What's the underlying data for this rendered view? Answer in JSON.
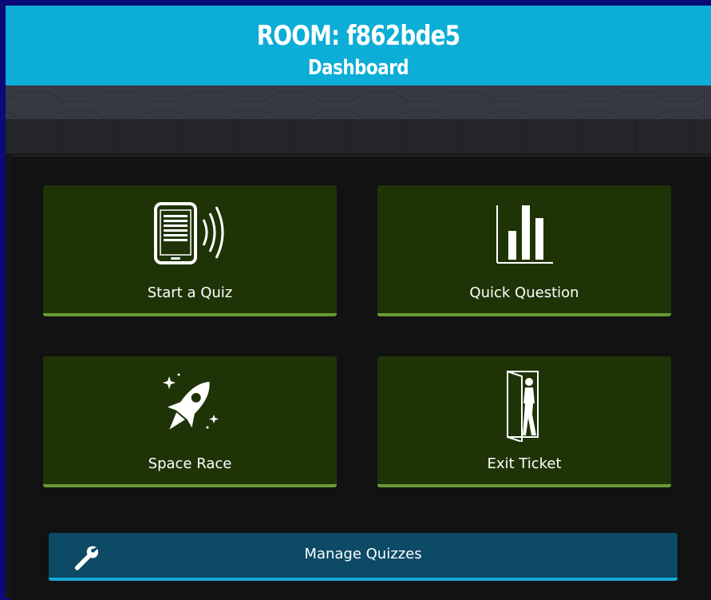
{
  "header": {
    "room_title": "ROOM: f862bde5",
    "subtitle": "Dashboard"
  },
  "tiles": [
    {
      "label": "Start a Quiz",
      "icon": "tablet-broadcast-icon"
    },
    {
      "label": "Quick Question",
      "icon": "bar-chart-icon"
    },
    {
      "label": "Space Race",
      "icon": "rocket-icon"
    },
    {
      "label": "Exit Ticket",
      "icon": "exit-door-icon"
    }
  ],
  "manage": {
    "label": "Manage Quizzes",
    "icon": "wrench-icon"
  },
  "colors": {
    "header_bg": "#0cadd6",
    "tile_bg": "#1f3406",
    "tile_accent": "#6a9a35",
    "manage_bg": "#0c4a66",
    "manage_accent": "#1aa8d6",
    "outer_bg": "#0a0a78"
  }
}
